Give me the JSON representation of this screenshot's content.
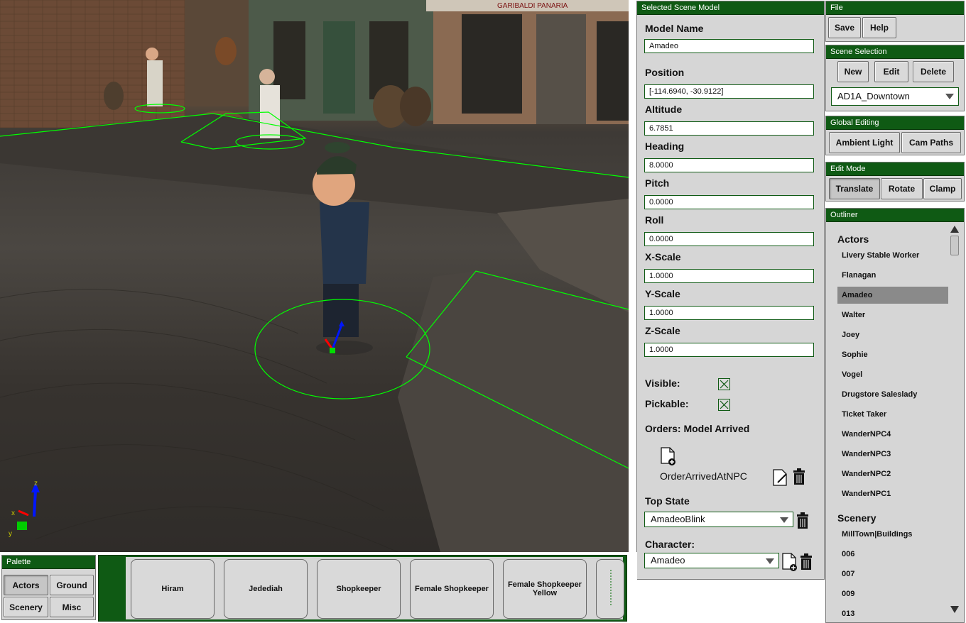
{
  "selected_model": {
    "header": "Selected Scene Model",
    "model_name_label": "Model Name",
    "model_name_value": "Amadeo",
    "position_label": "Position",
    "position_value": "[-114.6940, -30.9122]",
    "altitude_label": "Altitude",
    "altitude_value": "6.7851",
    "heading_label": "Heading",
    "heading_value": "8.0000",
    "pitch_label": "Pitch",
    "pitch_value": "0.0000",
    "roll_label": "Roll",
    "roll_value": "0.0000",
    "xscale_label": "X-Scale",
    "xscale_value": "1.0000",
    "yscale_label": "Y-Scale",
    "yscale_value": "1.0000",
    "zscale_label": "Z-Scale",
    "zscale_value": "1.0000",
    "visible_label": "Visible:",
    "pickable_label": "Pickable:",
    "orders_label": "Orders: Model Arrived",
    "order_name": "OrderArrivedAtNPC",
    "top_state_label": "Top State",
    "top_state_value": "AmadeoBlink",
    "character_label": "Character:",
    "character_value": "Amadeo"
  },
  "file": {
    "header": "File",
    "save": "Save",
    "help": "Help"
  },
  "scene_selection": {
    "header": "Scene Selection",
    "new": "New",
    "edit": "Edit",
    "delete": "Delete",
    "scene": "AD1A_Downtown"
  },
  "global_editing": {
    "header": "Global Editing",
    "ambient": "Ambient Light",
    "cam": "Cam Paths"
  },
  "edit_mode": {
    "header": "Edit Mode",
    "translate": "Translate",
    "rotate": "Rotate",
    "clamp": "Clamp"
  },
  "outliner": {
    "header": "Outliner",
    "actors_label": "Actors",
    "actors": [
      "Livery Stable Worker",
      "Flanagan",
      "Amadeo",
      "Walter",
      "Joey",
      "Sophie",
      "Vogel",
      "Drugstore Saleslady",
      "Ticket Taker",
      "WanderNPC4",
      "WanderNPC3",
      "WanderNPC2",
      "WanderNPC1"
    ],
    "scenery_label": "Scenery",
    "scenery": [
      "MillTown|Buildings",
      "006",
      "007",
      "009",
      "013"
    ]
  },
  "palette": {
    "header": "Palette",
    "actors": "Actors",
    "ground": "Ground",
    "scenery": "Scenery",
    "misc": "Misc",
    "cards": [
      "Hiram",
      "Jedediah",
      "Shopkeeper",
      "Female Shopkeeper",
      "Female Shopkeeper Yellow"
    ]
  },
  "viewport": {
    "sign_text": "GARIBALDI PANARIA",
    "axis_labels": {
      "x": "x",
      "y": "y",
      "z": "z"
    }
  },
  "colors": {
    "accent": "#0f5a14",
    "panel": "#d6d6d6",
    "selection": "#8a8a8a",
    "gizmo_green": "#00ff00"
  }
}
